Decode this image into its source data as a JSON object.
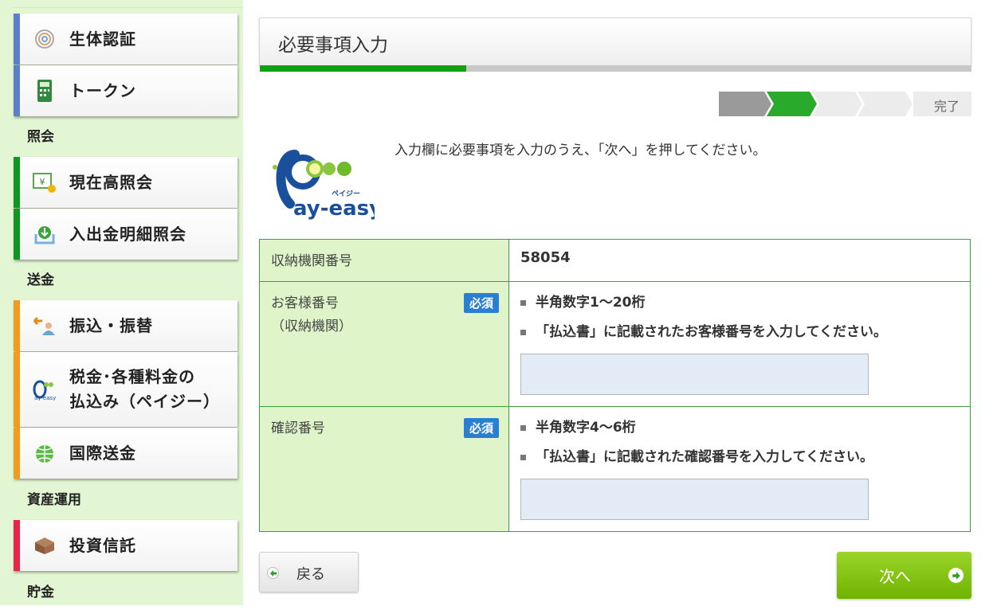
{
  "sidebar": {
    "sections": [
      {
        "label": "照会"
      },
      {
        "label": "送金"
      },
      {
        "label": "資産運用"
      },
      {
        "label": "貯金"
      }
    ],
    "items": [
      {
        "label": "生体認証",
        "icon": "fingerprint-icon"
      },
      {
        "label": "トークン",
        "icon": "token-device-icon"
      },
      {
        "label": "現在高照会",
        "icon": "yen-document-icon"
      },
      {
        "label": "入出金明細照会",
        "icon": "download-tray-icon"
      },
      {
        "label": "振込・振替",
        "icon": "transfer-person-icon"
      },
      {
        "label": "税金･各種料金の",
        "label2": "払込み（ペイジー）",
        "icon": "payeasy-icon"
      },
      {
        "label": "国際送金",
        "icon": "globe-icon"
      },
      {
        "label": "投資信託",
        "icon": "box-icon"
      }
    ]
  },
  "main": {
    "title": "必要事項入力",
    "progress_fraction": 0.29,
    "steps": {
      "total_arrows": 4,
      "completed": 1,
      "current": 2,
      "done_label": "完了"
    },
    "logo": {
      "text": "ay-easy",
      "ruby": "ペイジー"
    },
    "instruction": "入力欄に必要事項を入力のうえ、「次へ」を押してください。",
    "form": {
      "required_badge": "必須",
      "rows": [
        {
          "label": "収納機関番号",
          "value": "58054"
        },
        {
          "label": "お客様番号",
          "label_sub": "（収納機関）",
          "notes": [
            "半角数字1～20桁",
            "「払込書」に記載されたお客様番号を入力してください。"
          ],
          "input_value": ""
        },
        {
          "label": "確認番号",
          "notes": [
            "半角数字4～6桁",
            "「払込書」に記載された確認番号を入力してください。"
          ],
          "input_value": ""
        }
      ]
    },
    "buttons": {
      "back": "戻る",
      "next": "次へ"
    }
  },
  "colors": {
    "sidebar_bg": "#e2f6d3",
    "accent_green": "#12a012",
    "required_blue": "#2b7fd3",
    "next_green": "#7fc210",
    "border_blue": "#5b7fc9",
    "border_green": "#0b9a1f",
    "border_orange": "#f29b1c",
    "border_red": "#e8244a"
  }
}
